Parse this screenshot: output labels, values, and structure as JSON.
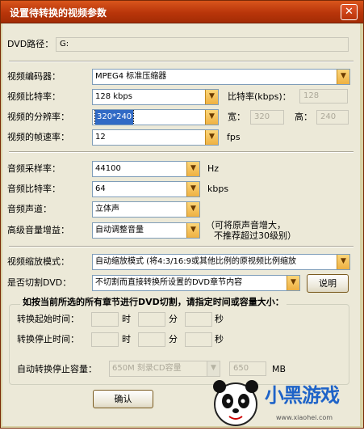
{
  "window": {
    "title": "设置待转换的视频参数",
    "close_glyph": "✕"
  },
  "dvd": {
    "label": "DVD路径：",
    "value": "G:"
  },
  "video": {
    "encoder_label": "视频编码器：",
    "encoder_value": "MPEG4 标准压缩器",
    "bitrate_label": "视频比特率：",
    "bitrate_value": "128 kbps",
    "bitrate_kbps_label": "比特率(kbps)：",
    "bitrate_kbps_value": "128",
    "resolution_label": "视频的分辨率：",
    "resolution_value": "320*240",
    "width_label": "宽：",
    "width_value": "320",
    "height_label": "高：",
    "height_value": "240",
    "framerate_label": "视频的帧速率：",
    "framerate_value": "12",
    "framerate_unit": "fps"
  },
  "audio": {
    "samplerate_label": "音频采样率：",
    "samplerate_value": "44100",
    "samplerate_unit": "Hz",
    "bitrate_label": "音频比特率：",
    "bitrate_value": "64",
    "bitrate_unit": "kbps",
    "channel_label": "音频声道：",
    "channel_value": "立体声",
    "gain_label": "高级音量增益：",
    "gain_value": "自动调整音量",
    "gain_hint_1": "（可将原声音增大，",
    "gain_hint_2": "不推荐超过30级别）"
  },
  "scale": {
    "label": "视频缩放模式：",
    "value": "自动缩放模式 (将4:3/16:9或其他比例的原视频比例缩放"
  },
  "cut": {
    "label": "是否切割DVD：",
    "value": "不切割而直接转换所设置的DVD章节内容",
    "help_button": "说明"
  },
  "group": {
    "title": "如按当前所选的所有章节进行DVD切割，请指定时间或容量大小：",
    "start_label": "转换起始时间：",
    "stop_label": "转换停止时间：",
    "hour_unit": "时",
    "minute_unit": "分",
    "second_unit": "秒",
    "capacity_label": "自动转换停止容量：",
    "capacity_preset": "650M 刻录CD容量",
    "capacity_value": "650",
    "capacity_unit": "MB"
  },
  "buttons": {
    "ok": "确认"
  },
  "logo": {
    "text": "小黑游戏",
    "url": "www.xiaohei.com"
  },
  "colors": {
    "titlebar": "#c0400e",
    "arrow": "#f4c35a",
    "selection": "#316ac5"
  }
}
